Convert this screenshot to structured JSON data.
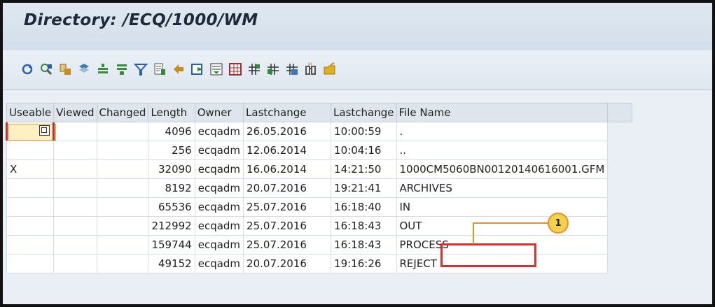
{
  "window": {
    "title": "Directory: /ECQ/1000/WM"
  },
  "toolbar": {
    "buttons": [
      {
        "icon": "refresh-icon",
        "color": "#2a5fa8"
      },
      {
        "icon": "details-icon",
        "color": "#2f8a3c"
      },
      {
        "icon": "sort-ascending-icon",
        "color": "#c98a1e"
      },
      {
        "icon": "sort-descending-icon",
        "color": "#3a7ab8"
      },
      {
        "icon": "sum-icon",
        "color": "#3c8a3c"
      },
      {
        "icon": "subtotal-icon",
        "color": "#3c8a3c"
      },
      {
        "icon": "filter-icon",
        "color": "#2a5fa8"
      },
      {
        "icon": "print-preview-icon",
        "color": "#555555"
      },
      {
        "icon": "export-icon",
        "color": "#c98a1e"
      },
      {
        "icon": "word-processing-icon",
        "color": "#2a5fa8"
      },
      {
        "icon": "abc-analysis-icon",
        "color": "#2f8a3c"
      },
      {
        "icon": "graphic-icon",
        "color": "#2a5fa8"
      },
      {
        "icon": "change-layout-icon",
        "color": "#2f8a3c"
      },
      {
        "icon": "select-layout-icon",
        "color": "#2f8a3c"
      },
      {
        "icon": "save-layout-icon",
        "color": "#2f8a3c"
      },
      {
        "icon": "find-icon",
        "color": "#555555"
      },
      {
        "icon": "open-folder-icon",
        "color": "#e0b020"
      }
    ]
  },
  "table": {
    "columns": [
      "Useable",
      "Viewed",
      "Changed",
      "Length",
      "Owner",
      "Lastchange",
      "Lastchange",
      "File Name"
    ],
    "rows": [
      {
        "useable": "",
        "viewed": "",
        "changed": "",
        "length": "4096",
        "owner": "ecqadm",
        "date": "26.05.2016",
        "time": "10:00:59",
        "file": "."
      },
      {
        "useable": "",
        "viewed": "",
        "changed": "",
        "length": "256",
        "owner": "ecqadm",
        "date": "12.06.2014",
        "time": "10:04:16",
        "file": ".."
      },
      {
        "useable": "X",
        "viewed": "",
        "changed": "",
        "length": "32090",
        "owner": "ecqadm",
        "date": "16.06.2014",
        "time": "14:21:50",
        "file": "1000CM5060BN00120140616001.GFM"
      },
      {
        "useable": "",
        "viewed": "",
        "changed": "",
        "length": "8192",
        "owner": "ecqadm",
        "date": "20.07.2016",
        "time": "19:21:41",
        "file": "ARCHIVES"
      },
      {
        "useable": "",
        "viewed": "",
        "changed": "",
        "length": "65536",
        "owner": "ecqadm",
        "date": "25.07.2016",
        "time": "16:18:40",
        "file": "IN"
      },
      {
        "useable": "",
        "viewed": "",
        "changed": "",
        "length": "212992",
        "owner": "ecqadm",
        "date": "25.07.2016",
        "time": "16:18:43",
        "file": "OUT"
      },
      {
        "useable": "",
        "viewed": "",
        "changed": "",
        "length": "159744",
        "owner": "ecqadm",
        "date": "25.07.2016",
        "time": "16:18:43",
        "file": "PROCESS"
      },
      {
        "useable": "",
        "viewed": "",
        "changed": "",
        "length": "49152",
        "owner": "ecqadm",
        "date": "20.07.2016",
        "time": "19:16:26",
        "file": "REJECT"
      }
    ]
  },
  "callout": {
    "number": "1",
    "target": "PROCESS",
    "box_color": "#d93030",
    "line_color": "#e8902a",
    "badge_color": "#f6d24a"
  }
}
